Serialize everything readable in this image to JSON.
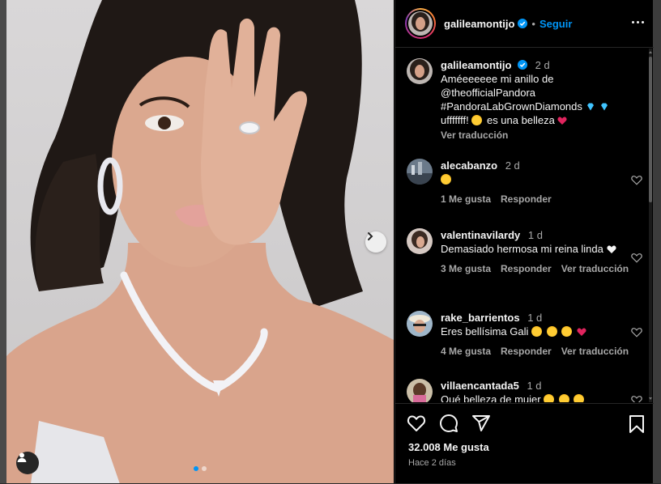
{
  "post": {
    "username": "galileamontijo",
    "follow_label": "Seguir",
    "separator": "•",
    "caption_time": "2 d",
    "caption_lines": [
      "Améeeeeee mi anillo de",
      "@theofficialPandora",
      "#PandoraLabGrownDiamonds",
      "ufffffff!",
      "es una belleza"
    ],
    "see_translation": "Ver traducción",
    "likes": "32.008 Me gusta",
    "posted_ago": "Hace 2 días",
    "carousel_total": 2,
    "carousel_index": 1
  },
  "comments": [
    {
      "username": "alecabanzo",
      "time": "2 d",
      "text": "",
      "likes": "1 Me gusta",
      "reply": "Responder",
      "translate": ""
    },
    {
      "username": "valentinavilardy",
      "time": "1 d",
      "text": "Demasiado hermosa mi reina linda",
      "likes": "3 Me gusta",
      "reply": "Responder",
      "translate": "Ver traducción"
    },
    {
      "username": "rake_barrientos",
      "time": "1 d",
      "text": "Eres bellísima Gali",
      "likes": "4 Me gusta",
      "reply": "Responder",
      "translate": "Ver traducción"
    },
    {
      "username": "villaencantada5",
      "time": "1 d",
      "text": "Qué belleza de mujer",
      "likes": "",
      "reply": "",
      "translate": ""
    }
  ],
  "icons": {
    "like": "heart-icon",
    "comment": "comment-icon",
    "share": "share-icon",
    "save": "bookmark-icon",
    "verified": "verified-badge-icon",
    "more": "more-options-icon",
    "next": "chevron-right-icon",
    "tags": "user-tag-icon"
  },
  "colors": {
    "link": "#0095f6",
    "secondary_text": "#a8a8a8",
    "heart_red": "#e0245e",
    "verified_blue": "#0095f6"
  }
}
